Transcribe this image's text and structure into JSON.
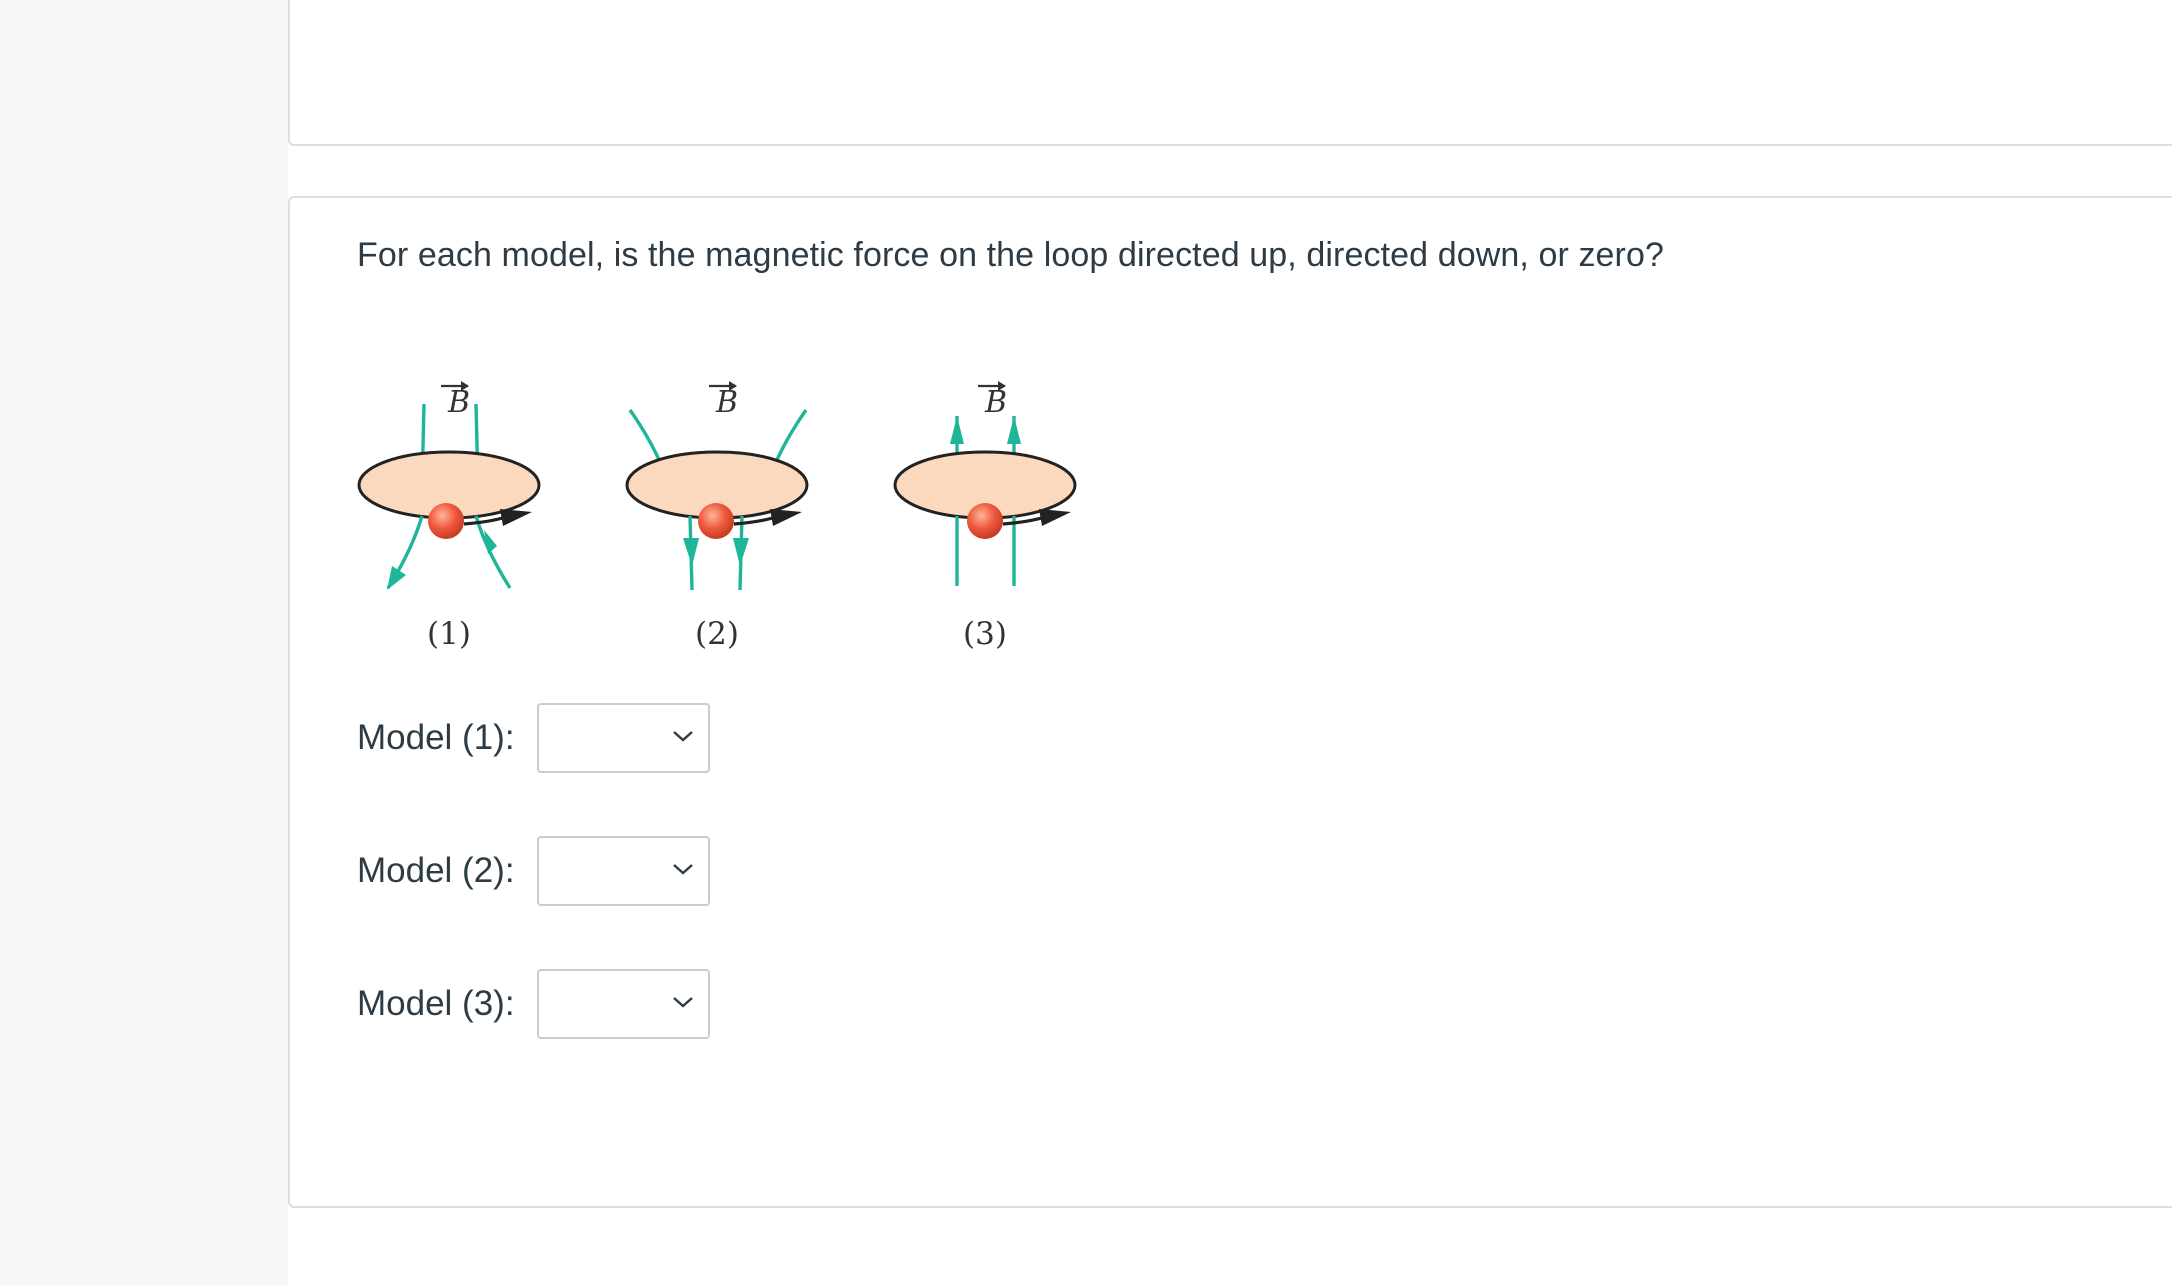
{
  "question": {
    "text": "For each model, is the magnetic force on the loop directed up, directed down, or zero?"
  },
  "figure": {
    "field_symbol": "B",
    "panels": [
      {
        "caption": "(1)",
        "field_shape": "diverging-downward"
      },
      {
        "caption": "(2)",
        "field_shape": "converging-downward"
      },
      {
        "caption": "(3)",
        "field_shape": "uniform-upward"
      }
    ],
    "colors": {
      "loop_fill": "#fbd9be",
      "field_lines": "#1eb598",
      "charge": "#e8503a",
      "velocity_arrow": "#222222"
    }
  },
  "answers": [
    {
      "label": "Model (1):",
      "selected": "",
      "icon": "chevron-down-icon"
    },
    {
      "label": "Model (2):",
      "selected": "",
      "icon": "chevron-down-icon"
    },
    {
      "label": "Model (3):",
      "selected": "",
      "icon": "chevron-down-icon"
    }
  ]
}
